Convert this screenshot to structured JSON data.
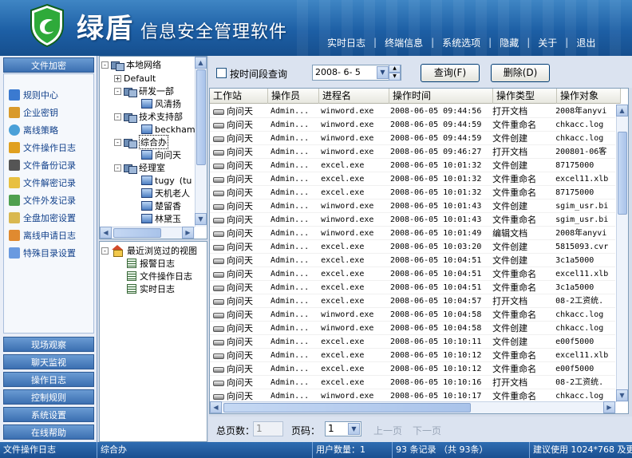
{
  "app": {
    "name": "绿盾",
    "subtitle": "信息安全管理软件",
    "brand_color": "#1d5fa5",
    "logo_color": "#2eaa3a"
  },
  "topnav": [
    "实时日志",
    "终端信息",
    "系统选项",
    "隐藏",
    "关于",
    "退出"
  ],
  "sidebar": {
    "header": "文件加密",
    "items": [
      {
        "label": "规则中心",
        "icon": "rules-icon"
      },
      {
        "label": "企业密钥",
        "icon": "key-icon"
      },
      {
        "label": "离线策略",
        "icon": "offline-policy-icon"
      },
      {
        "label": "文件操作日志",
        "icon": "file-log-icon"
      },
      {
        "label": "文件备份记录",
        "icon": "backup-icon"
      },
      {
        "label": "文件解密记录",
        "icon": "decrypt-icon"
      },
      {
        "label": "文件外发记录",
        "icon": "send-out-icon"
      },
      {
        "label": "全盘加密设置",
        "icon": "disk-encrypt-icon"
      },
      {
        "label": "离线申请日志",
        "icon": "offline-request-icon"
      },
      {
        "label": "特殊目录设置",
        "icon": "special-dir-icon"
      }
    ],
    "bottom_buttons": [
      "现场观察",
      "聊天监视",
      "操作日志",
      "控制规则",
      "系统设置",
      "在线帮助"
    ]
  },
  "tree": {
    "root": "本地网络",
    "nodes": [
      {
        "label": "Default",
        "type": "group",
        "toggle": "+"
      },
      {
        "label": "研发一部",
        "type": "group",
        "toggle": "-"
      },
      {
        "label": "风清扬",
        "type": "pc"
      },
      {
        "label": "技术支持部",
        "type": "group",
        "toggle": "-"
      },
      {
        "label": "beckham",
        "type": "pc"
      },
      {
        "label": "综合办",
        "type": "group",
        "toggle": "-",
        "selected": true
      },
      {
        "label": "向问天",
        "type": "pc"
      },
      {
        "label": "经理室",
        "type": "group",
        "toggle": "-"
      },
      {
        "label": "tugy",
        "type": "pc",
        "suffix": "(tu"
      },
      {
        "label": "天机老人",
        "type": "pc"
      },
      {
        "label": "楚留香",
        "type": "pc"
      },
      {
        "label": "林黛玉",
        "type": "pc"
      }
    ]
  },
  "recent_views": {
    "title": "最近浏览过的视图",
    "items": [
      "报警日志",
      "文件操作日志",
      "实时日志"
    ]
  },
  "toolbar": {
    "period_checkbox_label": "按时间段查询",
    "date_value": "2008- 6- 5",
    "query_button": "查询(F)",
    "delete_button": "删除(D)"
  },
  "grid": {
    "columns": [
      "工作站",
      "操作员",
      "进程名",
      "操作时间",
      "操作类型",
      "操作对象"
    ],
    "rows": [
      [
        "向问天",
        "Admin...",
        "winword.exe",
        "2008-06-05 09:44:56",
        "打开文档",
        "2008年anyvi"
      ],
      [
        "向问天",
        "Admin...",
        "winword.exe",
        "2008-06-05 09:44:59",
        "文件重命名",
        "chkacc.log"
      ],
      [
        "向问天",
        "Admin...",
        "winword.exe",
        "2008-06-05 09:44:59",
        "文件创建",
        "chkacc.log"
      ],
      [
        "向问天",
        "Admin...",
        "winword.exe",
        "2008-06-05 09:46:27",
        "打开文档",
        "200801-06客"
      ],
      [
        "向问天",
        "Admin...",
        "excel.exe",
        "2008-06-05 10:01:32",
        "文件创建",
        "87175000"
      ],
      [
        "向问天",
        "Admin...",
        "excel.exe",
        "2008-06-05 10:01:32",
        "文件重命名",
        "excel11.xlb"
      ],
      [
        "向问天",
        "Admin...",
        "excel.exe",
        "2008-06-05 10:01:32",
        "文件重命名",
        "87175000"
      ],
      [
        "向问天",
        "Admin...",
        "winword.exe",
        "2008-06-05 10:01:43",
        "文件创建",
        "sgim_usr.bi"
      ],
      [
        "向问天",
        "Admin...",
        "winword.exe",
        "2008-06-05 10:01:43",
        "文件重命名",
        "sgim_usr.bi"
      ],
      [
        "向问天",
        "Admin...",
        "winword.exe",
        "2008-06-05 10:01:49",
        "编辑文档",
        "2008年anyvi"
      ],
      [
        "向问天",
        "Admin...",
        "excel.exe",
        "2008-06-05 10:03:20",
        "文件创建",
        "5815093.cvr"
      ],
      [
        "向问天",
        "Admin...",
        "excel.exe",
        "2008-06-05 10:04:51",
        "文件创建",
        "3c1a5000"
      ],
      [
        "向问天",
        "Admin...",
        "excel.exe",
        "2008-06-05 10:04:51",
        "文件重命名",
        "excel11.xlb"
      ],
      [
        "向问天",
        "Admin...",
        "excel.exe",
        "2008-06-05 10:04:51",
        "文件重命名",
        "3c1a5000"
      ],
      [
        "向问天",
        "Admin...",
        "excel.exe",
        "2008-06-05 10:04:57",
        "打开文档",
        "08-2工资统."
      ],
      [
        "向问天",
        "Admin...",
        "winword.exe",
        "2008-06-05 10:04:58",
        "文件重命名",
        "chkacc.log"
      ],
      [
        "向问天",
        "Admin...",
        "winword.exe",
        "2008-06-05 10:04:58",
        "文件创建",
        "chkacc.log"
      ],
      [
        "向问天",
        "Admin...",
        "excel.exe",
        "2008-06-05 10:10:11",
        "文件创建",
        "e00f5000"
      ],
      [
        "向问天",
        "Admin...",
        "excel.exe",
        "2008-06-05 10:10:12",
        "文件重命名",
        "excel11.xlb"
      ],
      [
        "向问天",
        "Admin...",
        "excel.exe",
        "2008-06-05 10:10:12",
        "文件重命名",
        "e00f5000"
      ],
      [
        "向问天",
        "Admin...",
        "excel.exe",
        "2008-06-05 10:10:16",
        "打开文档",
        "08-2工资统."
      ],
      [
        "向问天",
        "Admin...",
        "winword.exe",
        "2008-06-05 10:10:17",
        "文件重命名",
        "chkacc.log"
      ]
    ]
  },
  "pager": {
    "total_pages_label": "总页数：",
    "total_pages_value": "1",
    "page_label": "页码：",
    "page_value": "1",
    "prev": "上一页",
    "next": "下一页"
  },
  "status": {
    "module": "文件操作日志",
    "selected": "综合办",
    "user_count": "用户数量：1",
    "records": "93 条记录 （共 93条）",
    "hint": "建议使用 1024*768 及更"
  }
}
